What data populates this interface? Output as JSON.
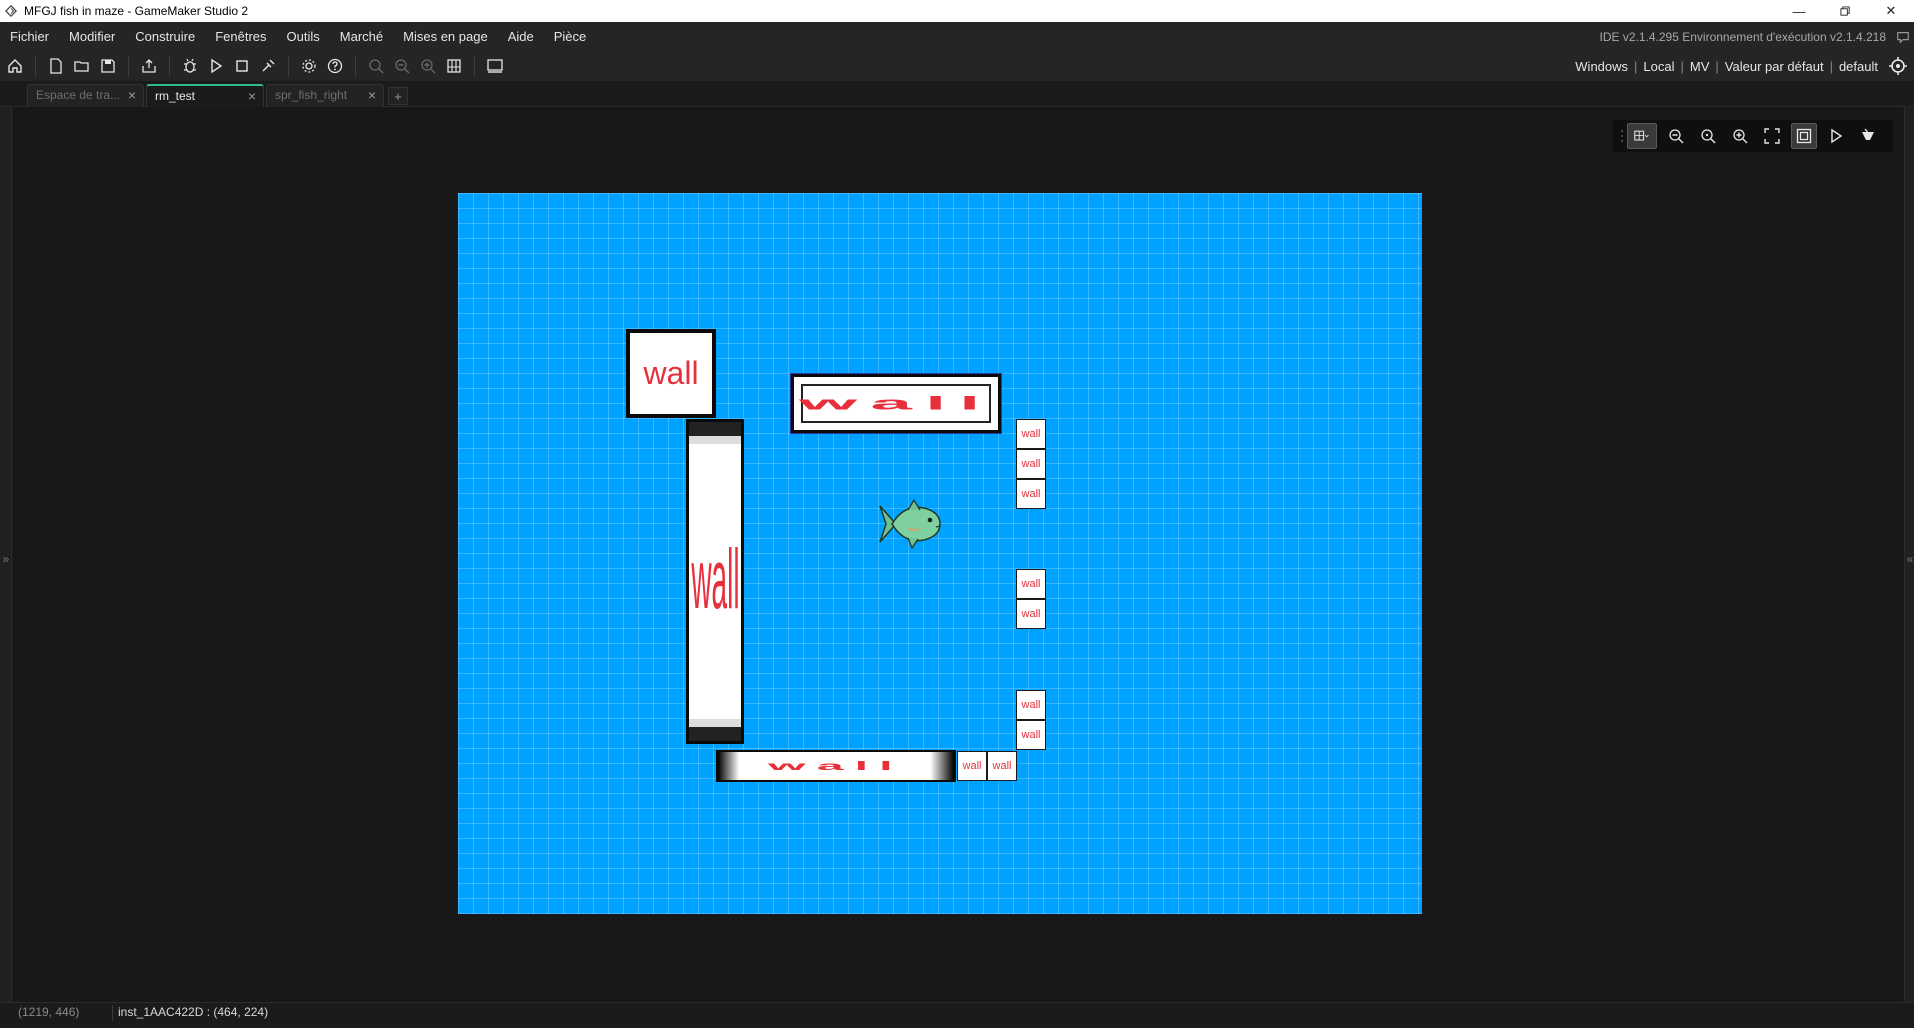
{
  "window": {
    "title": "MFGJ fish in maze - GameMaker Studio 2",
    "controls": [
      "minimize",
      "restore",
      "close"
    ]
  },
  "menu": {
    "items": [
      "Fichier",
      "Modifier",
      "Construire",
      "Fenêtres",
      "Outils",
      "Marché",
      "Mises en page",
      "Aide",
      "Pièce"
    ],
    "ide_version": "IDE v2.1.4.295 Environnement d'exécution v2.1.4.218"
  },
  "toolbar": {
    "icons": [
      "home-icon",
      "new-project-icon",
      "open-project-icon",
      "save-project-icon",
      "create-executable-icon",
      "debug-icon",
      "run-icon",
      "stop-icon",
      "clean-icon",
      "game-options-icon",
      "help-icon",
      "zoom-reset-icon",
      "zoom-out-icon",
      "zoom-in-icon",
      "layout-icon",
      "output-window-icon"
    ],
    "target": {
      "platform": "Windows",
      "device": "Local",
      "vm": "MV",
      "config": "Valeur par défaut",
      "config2": "default"
    }
  },
  "tabs": [
    {
      "label": "Espace de tra...",
      "active": false
    },
    {
      "label": "rm_test",
      "active": true
    },
    {
      "label": "spr_fish_right",
      "active": false
    }
  ],
  "room_toolbar": {
    "icons": [
      "grid-icon",
      "zoom-out-icon",
      "zoom-reset-icon",
      "zoom-in-icon",
      "fit-icon",
      "frame-icon",
      "play-icon",
      "clear-icon"
    ]
  },
  "room": {
    "background_color": "#00a2ff",
    "wall_label": "wall",
    "wall_text_color": "#e8303c"
  },
  "status": {
    "mouse_coords": "(1219, 446)",
    "instance_info": "inst_1AAC422D : (464, 224)"
  }
}
